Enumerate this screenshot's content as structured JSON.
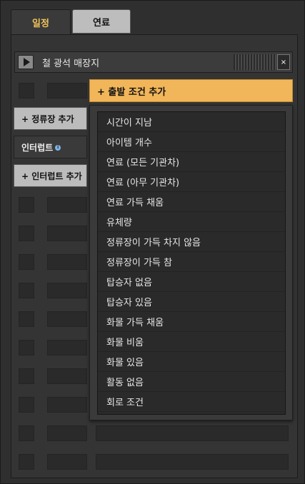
{
  "tabs": [
    {
      "label": "일정",
      "active": true
    },
    {
      "label": "연료",
      "active": false
    }
  ],
  "station": {
    "name": "철 광석 매장지"
  },
  "close_label": "×",
  "left_buttons": {
    "add_station": "+ 정류장 추가",
    "interrupt": "인터럽트",
    "add_interrupt": "+ 인터럽트 추가"
  },
  "add_condition_label": "+ 출발 조건 추가",
  "conditions": [
    "시간이 지남",
    "아이템 개수",
    "연료 (모든 기관차)",
    "연료 (아무 기관차)",
    "연료 가득 채움",
    "유체량",
    "정류장이 가득 차지 않음",
    "정류장이 가득 참",
    "탑승자 없음",
    "탑승자 있음",
    "화물 가득 채움",
    "화물 비움",
    "화물 있음",
    "활동 없음",
    "회로 조건"
  ],
  "colors": {
    "accent": "#f2b65a",
    "tab_active_text": "#f0c35a",
    "info": "#7fb2e6"
  }
}
